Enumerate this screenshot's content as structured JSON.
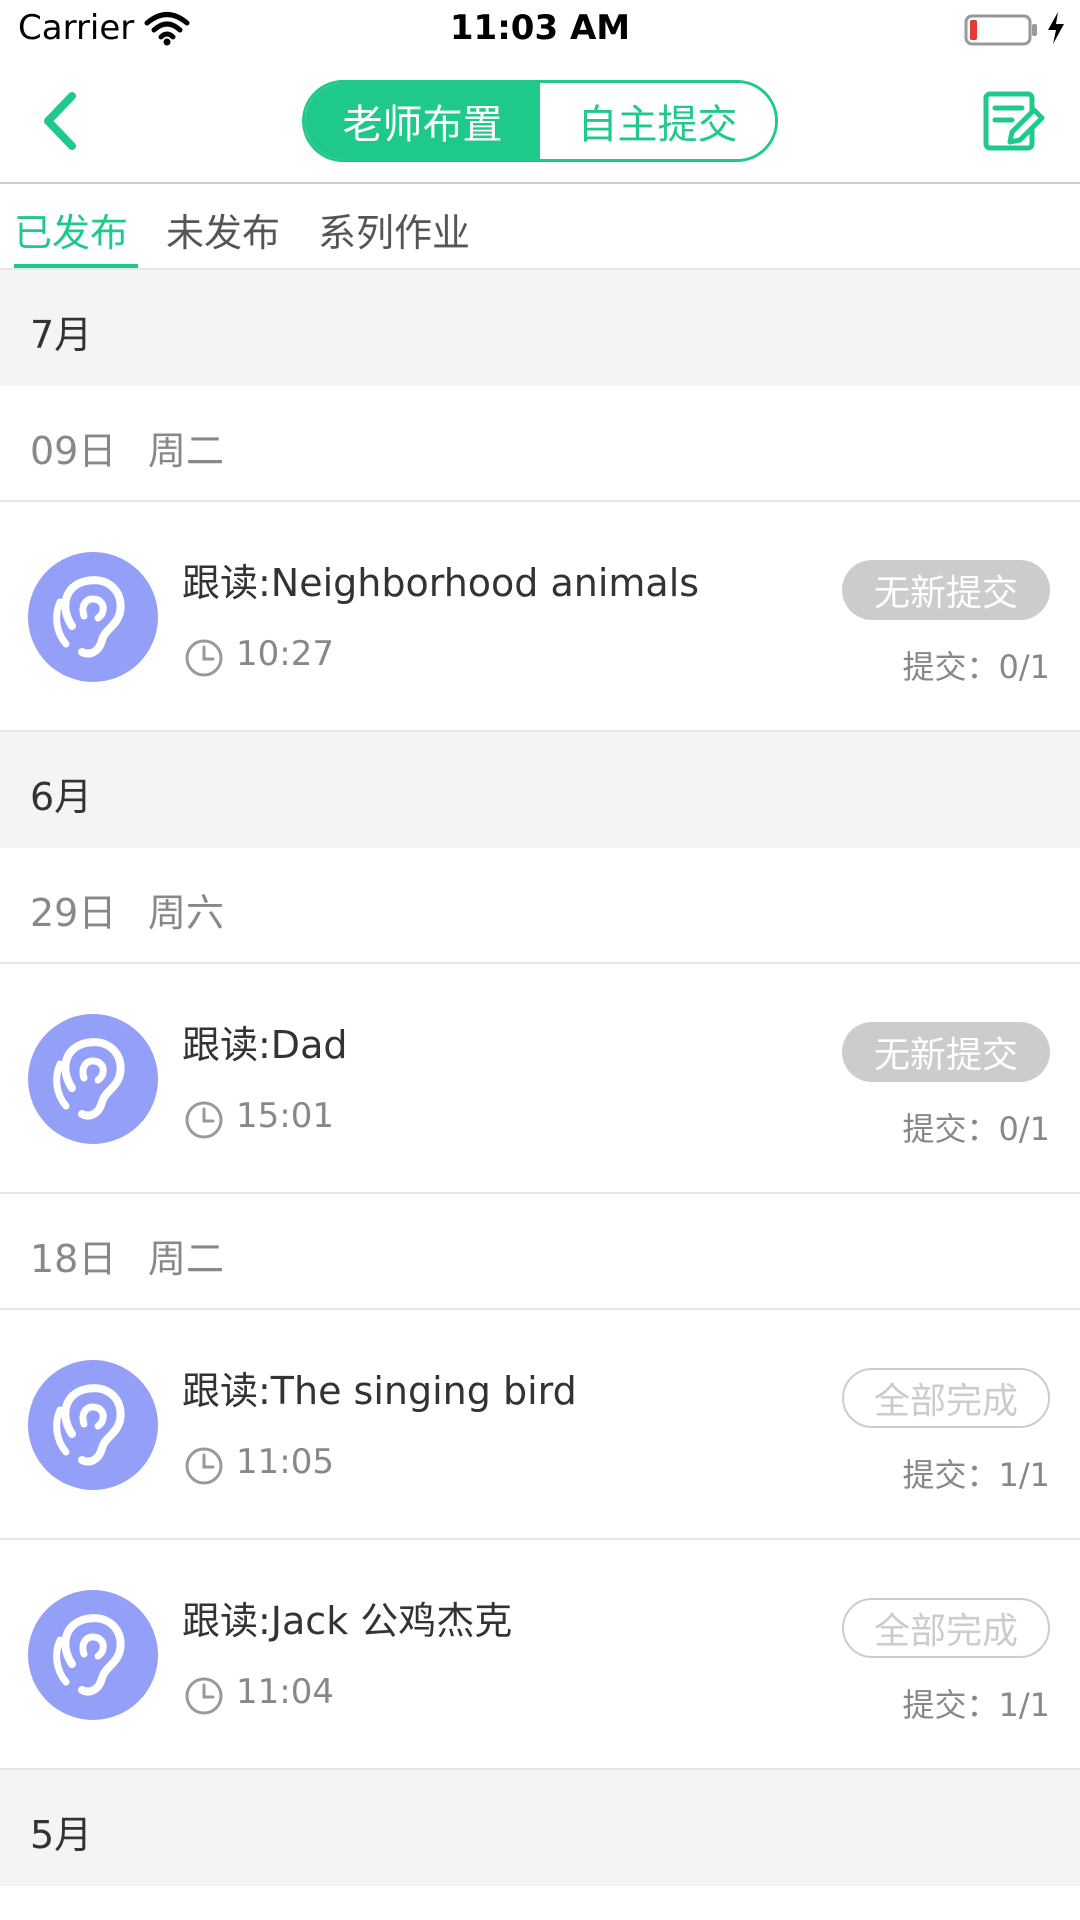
{
  "status_bar": {
    "carrier": "Carrier",
    "time": "11:03 AM"
  },
  "nav": {
    "segments": [
      "老师布置",
      "自主提交"
    ],
    "active_segment": 0,
    "back_icon": "chevron-left-icon",
    "edit_icon": "edit-note-icon"
  },
  "subtabs": {
    "items": [
      "已发布",
      "未发布",
      "系列作业"
    ],
    "active": 0
  },
  "months": {
    "m7": "7月",
    "m6": "6月",
    "m5": "5月"
  },
  "days": [
    {
      "date": "09日",
      "weekday": "周二"
    },
    {
      "date": "29日",
      "weekday": "周六"
    },
    {
      "date": "18日",
      "weekday": "周二"
    }
  ],
  "tasks": [
    {
      "title": "跟读:Neighborhood animals",
      "time": "10:27",
      "badge": "无新提交",
      "submit": "提交：0/1"
    },
    {
      "title": "跟读:Dad",
      "time": "15:01",
      "badge": "无新提交",
      "submit": "提交：0/1"
    },
    {
      "title": "跟读:The singing bird",
      "time": "11:05",
      "badge": "全部完成",
      "submit": "提交：1/1"
    },
    {
      "title": "跟读:Jack 公鸡杰克",
      "time": "11:04",
      "badge": "全部完成",
      "submit": "提交：1/1"
    }
  ],
  "colors": {
    "accent": "#1fc98b",
    "avatar": "#94a0f7",
    "badge_gray": "#cccccc"
  },
  "icons": {
    "task": "ear-icon",
    "time": "clock-icon"
  }
}
